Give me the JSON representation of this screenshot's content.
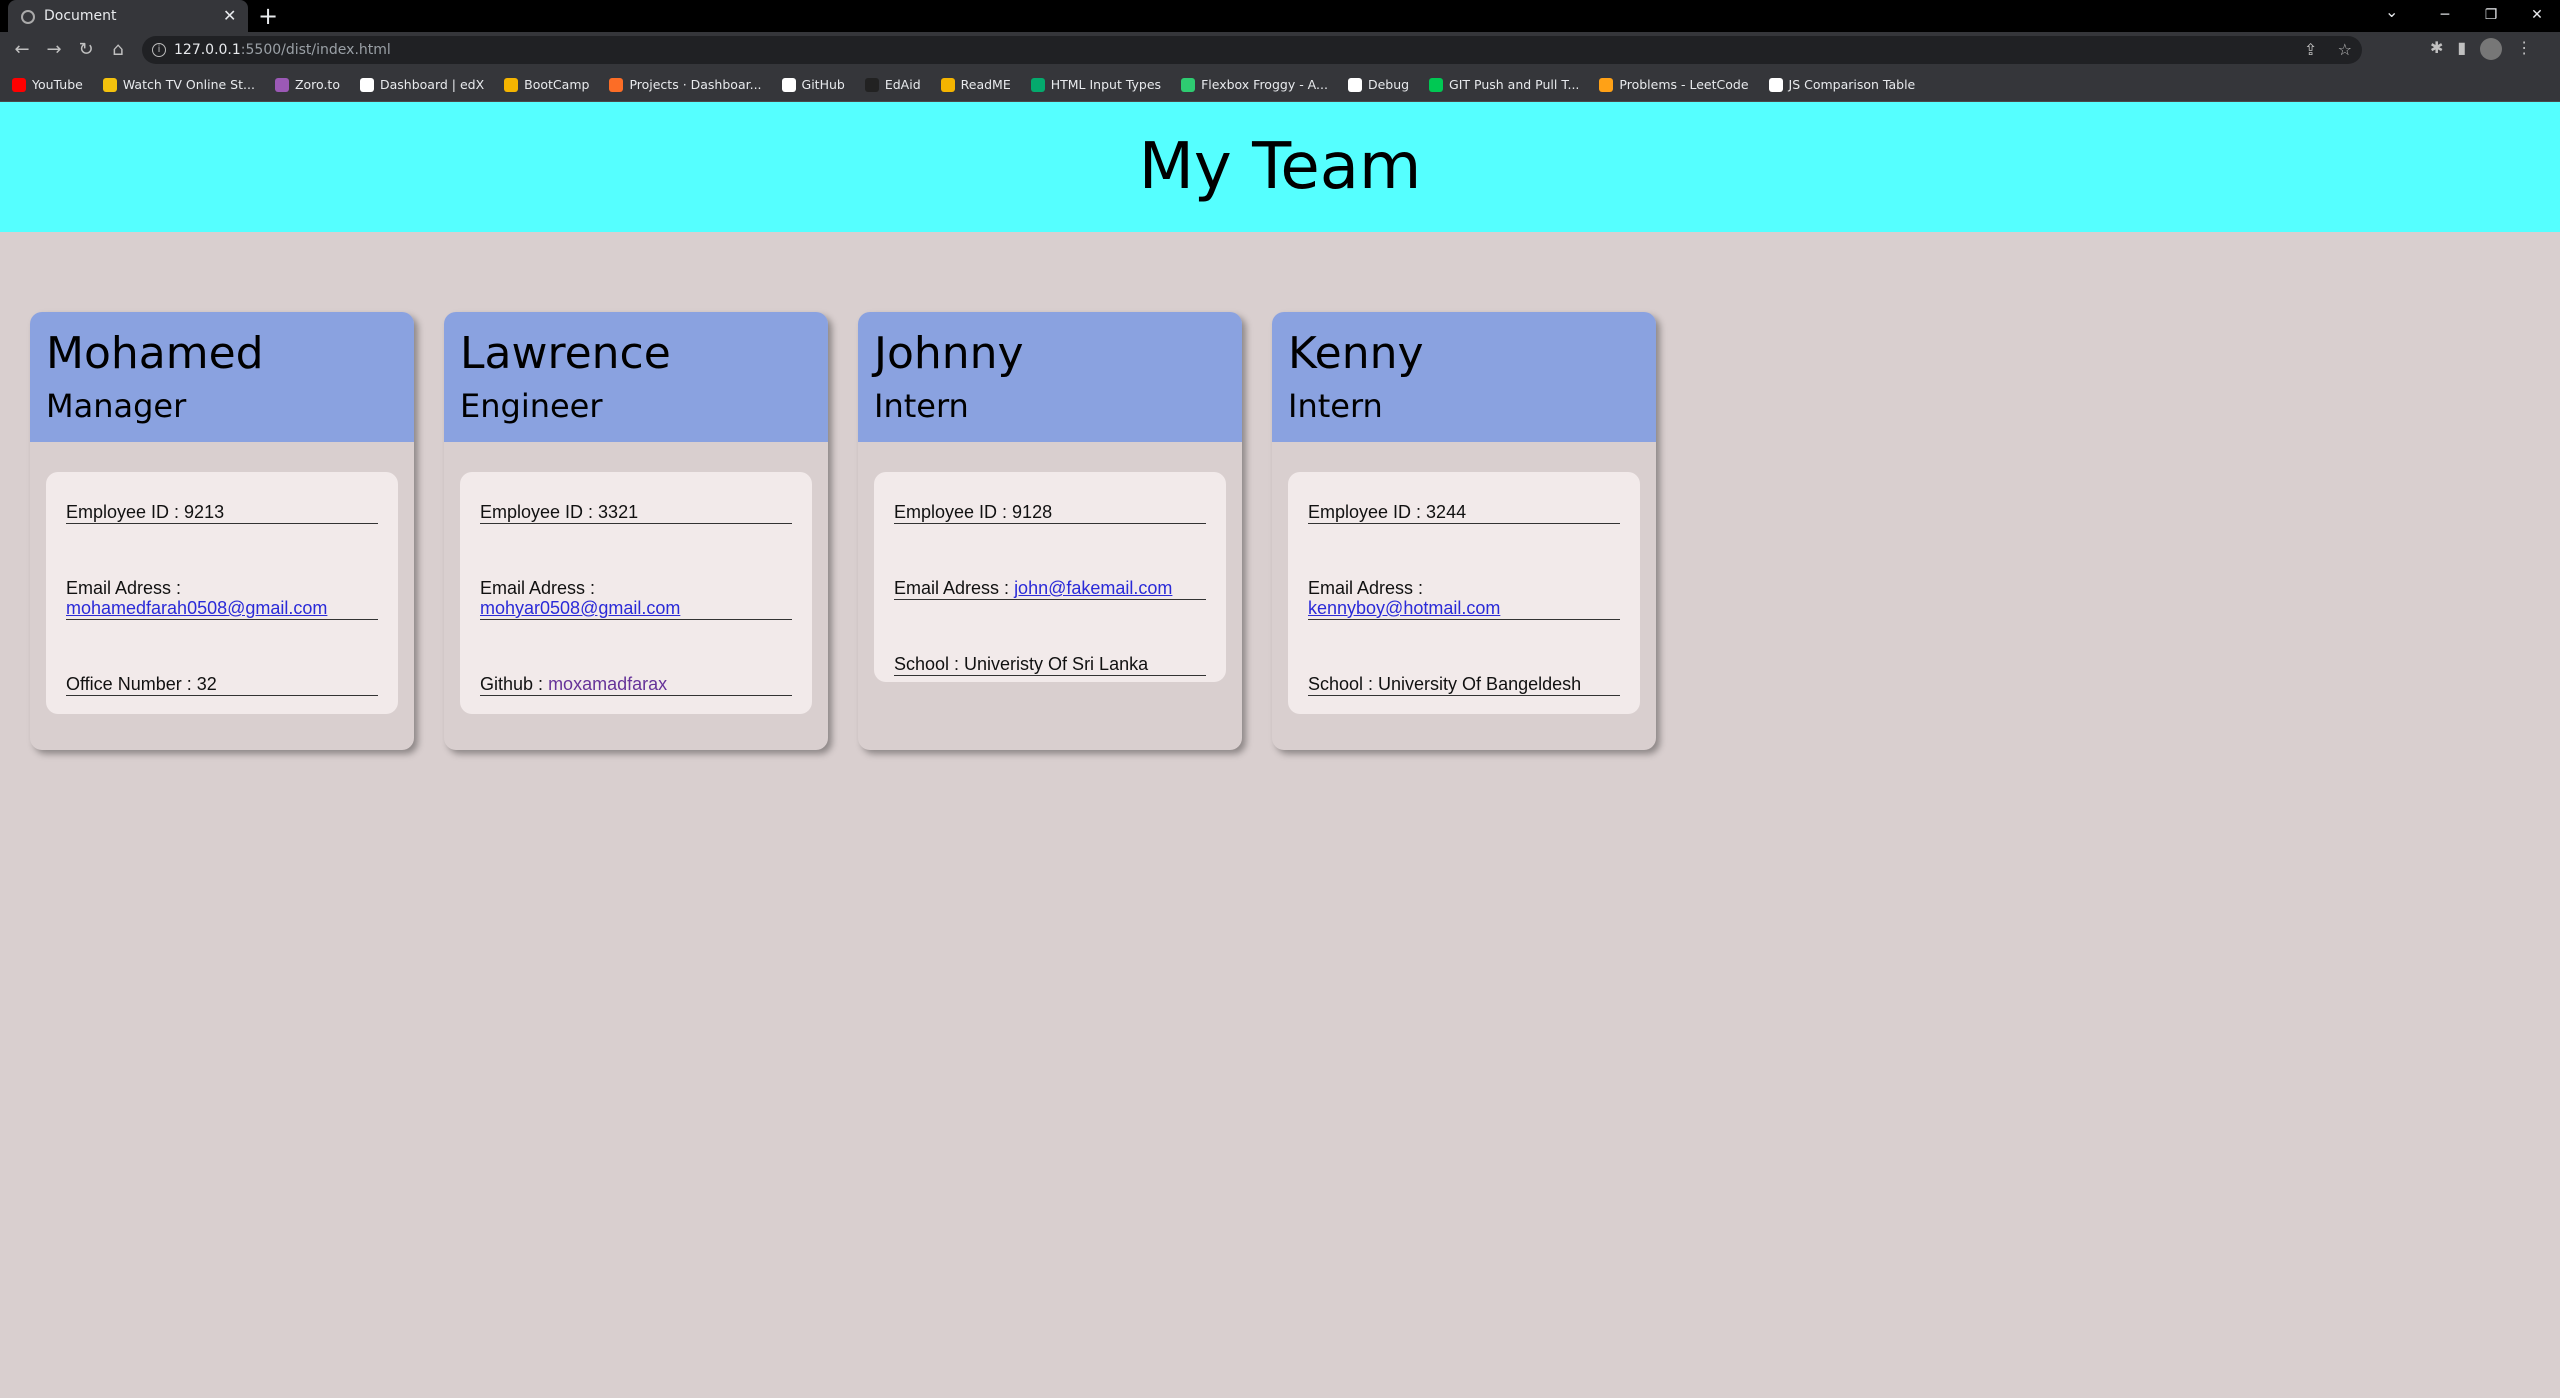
{
  "browser": {
    "tab_title": "Document",
    "url_host": "127.0.0.1",
    "url_path": ":5500/dist/index.html",
    "bookmarks": [
      {
        "label": "YouTube",
        "color": "#ff0000"
      },
      {
        "label": "Watch TV Online St...",
        "color": "#f4c20d"
      },
      {
        "label": "Zoro.to",
        "color": "#9b59b6"
      },
      {
        "label": "Dashboard | edX",
        "color": "#ffffff"
      },
      {
        "label": "BootCamp",
        "color": "#f4b400"
      },
      {
        "label": "Projects · Dashboar...",
        "color": "#fc6d26"
      },
      {
        "label": "GitHub",
        "color": "#ffffff"
      },
      {
        "label": "EdAid",
        "color": "#222222"
      },
      {
        "label": "ReadME",
        "color": "#f4b400"
      },
      {
        "label": "HTML Input Types",
        "color": "#04aa6d"
      },
      {
        "label": "Flexbox Froggy - A...",
        "color": "#2ecc71"
      },
      {
        "label": "Debug",
        "color": "#ffffff"
      },
      {
        "label": "GIT Push and Pull T...",
        "color": "#00c853"
      },
      {
        "label": "Problems - LeetCode",
        "color": "#ffa116"
      },
      {
        "label": "JS Comparison Table",
        "color": "#ffffff"
      }
    ]
  },
  "page": {
    "title": "My Team",
    "header_color": "#55ffff",
    "card_header_color": "#8aa2e0"
  },
  "team": [
    {
      "name": "Mohamed",
      "role": "Manager",
      "id_text": "Employee ID : 9213",
      "email_label": "Email Adress :",
      "email": "mohamedfarah0508@gmail.com",
      "extra_label": "Office Number : 32",
      "extra_link": ""
    },
    {
      "name": "Lawrence",
      "role": "Engineer",
      "id_text": "Employee ID : 3321",
      "email_label": "Email Adress :",
      "email": "mohyar0508@gmail.com",
      "extra_label": "Github :",
      "extra_link": "moxamadfarax"
    },
    {
      "name": "Johnny",
      "role": "Intern",
      "id_text": "Employee ID : 9128",
      "email_label": "Email Adress :",
      "email": "john@fakemail.com",
      "extra_label": "School : Univeristy Of Sri Lanka",
      "extra_link": ""
    },
    {
      "name": "Kenny",
      "role": "Intern",
      "id_text": "Employee ID : 3244",
      "email_label": "Email Adress :",
      "email": "kennyboy@hotmail.com",
      "extra_label": "School : University Of Bangeldesh",
      "extra_link": ""
    }
  ]
}
